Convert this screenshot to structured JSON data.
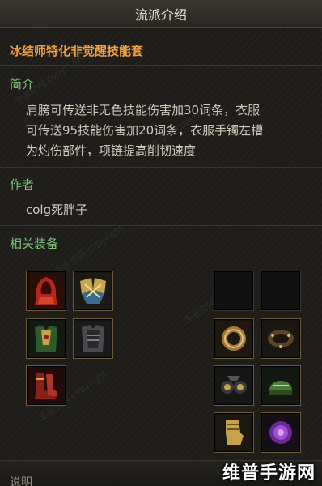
{
  "header": {
    "title": "流派介绍"
  },
  "build": {
    "name": "冰结师特化非觉醒技能套"
  },
  "intro": {
    "heading": "简介",
    "lines": [
      "肩膀可传送非无色技能伤害加30词条，衣服",
      "可传送95技能伤害加20词条，衣服手镯左槽",
      "为灼伤部件，项链提高削韧速度"
    ]
  },
  "author": {
    "heading": "作者",
    "name": "colg死胖子"
  },
  "equipment": {
    "heading": "相关装备",
    "left_slots": [
      {
        "icon": "red-hood-armor-icon"
      },
      {
        "icon": "golden-shoulder-armor-icon"
      },
      {
        "icon": "green-gold-chest-armor-icon"
      },
      {
        "icon": "dark-plate-armor-icon"
      },
      {
        "icon": "red-boots-icon"
      }
    ],
    "right_slots": [
      {
        "icon": "empty-slot"
      },
      {
        "icon": "empty-slot"
      },
      {
        "icon": "bronze-bracelet-icon"
      },
      {
        "icon": "studded-ring-icon"
      },
      {
        "icon": "dark-goggles-icon"
      },
      {
        "icon": "green-helmet-icon"
      },
      {
        "icon": "golden-gauntlet-icon"
      },
      {
        "icon": "purple-rose-gem-icon"
      }
    ]
  },
  "footer": {
    "label": "说明"
  },
  "watermark": {
    "text": "维普手游网",
    "bg_text": "无名空间 copyright"
  },
  "colors": {
    "accent": "#f0a042",
    "section": "#7fc17a"
  }
}
